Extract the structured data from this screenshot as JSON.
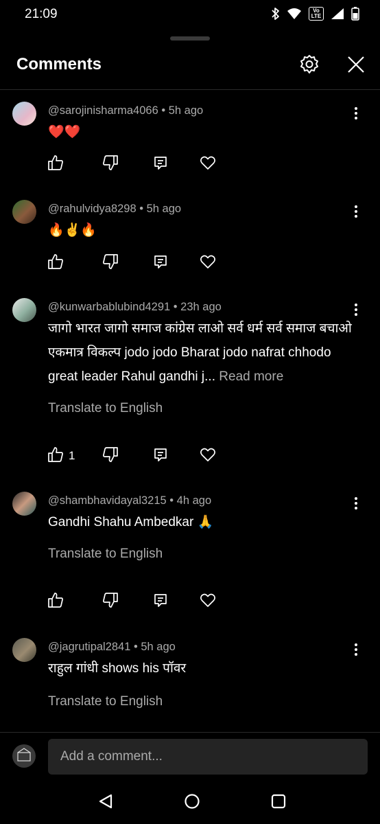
{
  "status_bar": {
    "time": "21:09",
    "volte_label": "Vo LTE"
  },
  "header": {
    "title": "Comments"
  },
  "comments": [
    {
      "author": "@sarojinisharma4066",
      "time": "5h ago",
      "text": "❤️❤️"
    },
    {
      "author": "@rahulvidya8298",
      "time": "5h ago",
      "text": "🔥✌️🔥"
    },
    {
      "author": "@kunwarbablubind4291",
      "time": "23h ago",
      "text": "जागो भारत जागो समाज कांग्रेस लाओ सर्व धर्म सर्व समाज बचाओ एकमात्र विकल्प jodo jodo Bharat jodo nafrat chhodo great leader Rahul gandhi j...",
      "read_more": "Read more",
      "translate": "Translate to English",
      "likes": "1"
    },
    {
      "author": "@shambhavidayal3215",
      "time": "4h ago",
      "text": "Gandhi Shahu Ambedkar 🙏",
      "translate": "Translate to English"
    },
    {
      "author": "@jagrutipal2841",
      "time": "5h ago",
      "text": "राहुल गांधी shows his पॉवर",
      "translate": "Translate to English"
    }
  ],
  "composer": {
    "placeholder": "Add a comment..."
  },
  "icons": {
    "settings": "gear-icon",
    "close": "close-icon",
    "like": "thumbs-up-icon",
    "dislike": "thumbs-down-icon",
    "reply": "reply-icon",
    "heart": "heart-icon",
    "more": "more-vert-icon",
    "back": "back-triangle-icon",
    "home": "home-circle-icon",
    "recents": "recents-square-icon"
  },
  "colors": {
    "background": "#000000",
    "secondary_text": "#aaaaaa",
    "input_bg": "#242424"
  }
}
